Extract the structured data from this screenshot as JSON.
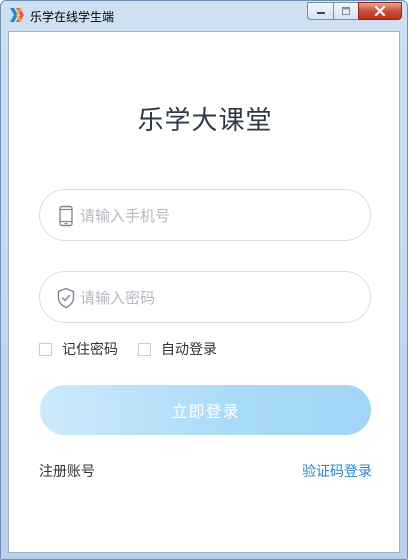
{
  "window": {
    "title": "乐学在线学生端",
    "colors": {
      "accent": "#2b86c7",
      "button_gradient_start": "#cde9fb",
      "button_gradient_end": "#a2d6f8"
    },
    "controls": {
      "minimize": "minimize-icon",
      "maximize": "maximize-icon",
      "close": "close-icon"
    }
  },
  "main": {
    "heading": "乐学大课堂",
    "phone_field": {
      "icon": "phone-icon",
      "placeholder": "请输入手机号",
      "value": ""
    },
    "password_field": {
      "icon": "shield-icon",
      "placeholder": "请输入密码",
      "value": ""
    },
    "remember_password": {
      "label": "记住密码",
      "checked": false
    },
    "auto_login": {
      "label": "自动登录",
      "checked": false
    },
    "login_button": "立即登录",
    "register_link": "注册账号",
    "sms_login_link": "验证码登录"
  }
}
